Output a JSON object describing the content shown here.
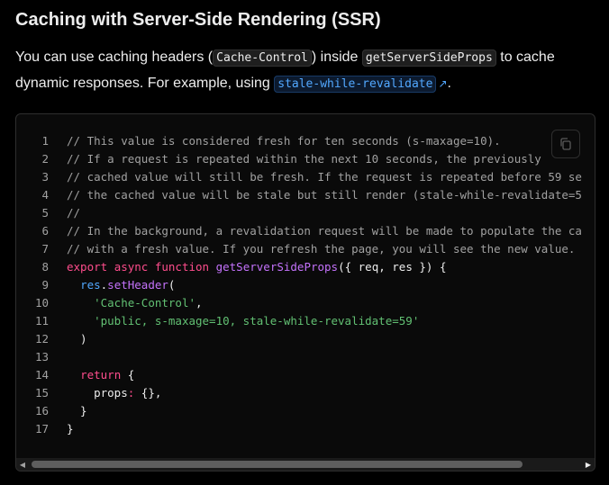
{
  "heading": "Caching with Server-Side Rendering (SSR)",
  "paragraph": {
    "part1": "You can use caching headers (",
    "code1": "Cache-Control",
    "part2": ") inside ",
    "code2": "getServerSideProps",
    "part3": " to cache dynamic responses. For example, using ",
    "link": "stale-while-revalidate",
    "link_arrow": "↗",
    "part4": "."
  },
  "code_block": {
    "copy_icon": "copy-icon",
    "lines": [
      {
        "n": "1",
        "t": [
          {
            "c": "// This value is considered fresh for ten seconds (s-maxage=10).",
            "k": "comment"
          }
        ]
      },
      {
        "n": "2",
        "t": [
          {
            "c": "// If a request is repeated within the next 10 seconds, the previously",
            "k": "comment"
          }
        ]
      },
      {
        "n": "3",
        "t": [
          {
            "c": "// cached value will still be fresh. If the request is repeated before 59 se",
            "k": "comment"
          }
        ]
      },
      {
        "n": "4",
        "t": [
          {
            "c": "// the cached value will be stale but still render (stale-while-revalidate=5",
            "k": "comment"
          }
        ]
      },
      {
        "n": "5",
        "t": [
          {
            "c": "//",
            "k": "comment"
          }
        ]
      },
      {
        "n": "6",
        "t": [
          {
            "c": "// In the background, a revalidation request will be made to populate the ca",
            "k": "comment"
          }
        ]
      },
      {
        "n": "7",
        "t": [
          {
            "c": "// with a fresh value. If you refresh the page, you will see the new value.",
            "k": "comment"
          }
        ]
      },
      {
        "n": "8",
        "t": [
          {
            "c": "export",
            "k": "keyword"
          },
          {
            "c": " ",
            "k": "plain"
          },
          {
            "c": "async",
            "k": "keyword"
          },
          {
            "c": " ",
            "k": "plain"
          },
          {
            "c": "function",
            "k": "keyword"
          },
          {
            "c": " ",
            "k": "plain"
          },
          {
            "c": "getServerSideProps",
            "k": "function"
          },
          {
            "c": "({ req, res }) {",
            "k": "plain"
          }
        ]
      },
      {
        "n": "9",
        "t": [
          {
            "c": "  ",
            "k": "plain"
          },
          {
            "c": "res",
            "k": "property"
          },
          {
            "c": ".",
            "k": "plain"
          },
          {
            "c": "setHeader",
            "k": "function"
          },
          {
            "c": "(",
            "k": "plain"
          }
        ]
      },
      {
        "n": "10",
        "t": [
          {
            "c": "    ",
            "k": "plain"
          },
          {
            "c": "'Cache-Control'",
            "k": "string"
          },
          {
            "c": ",",
            "k": "plain"
          }
        ]
      },
      {
        "n": "11",
        "t": [
          {
            "c": "    ",
            "k": "plain"
          },
          {
            "c": "'public, s-maxage=10, stale-while-revalidate=59'",
            "k": "string"
          }
        ]
      },
      {
        "n": "12",
        "t": [
          {
            "c": "  )",
            "k": "plain"
          }
        ]
      },
      {
        "n": "13",
        "t": [
          {
            "c": "",
            "k": "plain"
          }
        ]
      },
      {
        "n": "14",
        "t": [
          {
            "c": "  ",
            "k": "plain"
          },
          {
            "c": "return",
            "k": "keyword"
          },
          {
            "c": " {",
            "k": "plain"
          }
        ]
      },
      {
        "n": "15",
        "t": [
          {
            "c": "    props",
            "k": "plain"
          },
          {
            "c": ":",
            "k": "keyword"
          },
          {
            "c": " {},",
            "k": "plain"
          }
        ]
      },
      {
        "n": "16",
        "t": [
          {
            "c": "  }",
            "k": "plain"
          }
        ]
      },
      {
        "n": "17",
        "t": [
          {
            "c": "}",
            "k": "plain"
          }
        ]
      }
    ]
  },
  "scrollbar": {
    "left_arrow": "◀",
    "right_arrow": "▶",
    "scroll_fraction": 0
  },
  "colors": {
    "background": "#000000",
    "code_background": "#0a0a0a",
    "comment": "#a1a1a1",
    "keyword": "#ff4d8d",
    "function": "#c472fb",
    "string": "#62c073",
    "property": "#52a8ff",
    "link": "#52a8ff"
  }
}
